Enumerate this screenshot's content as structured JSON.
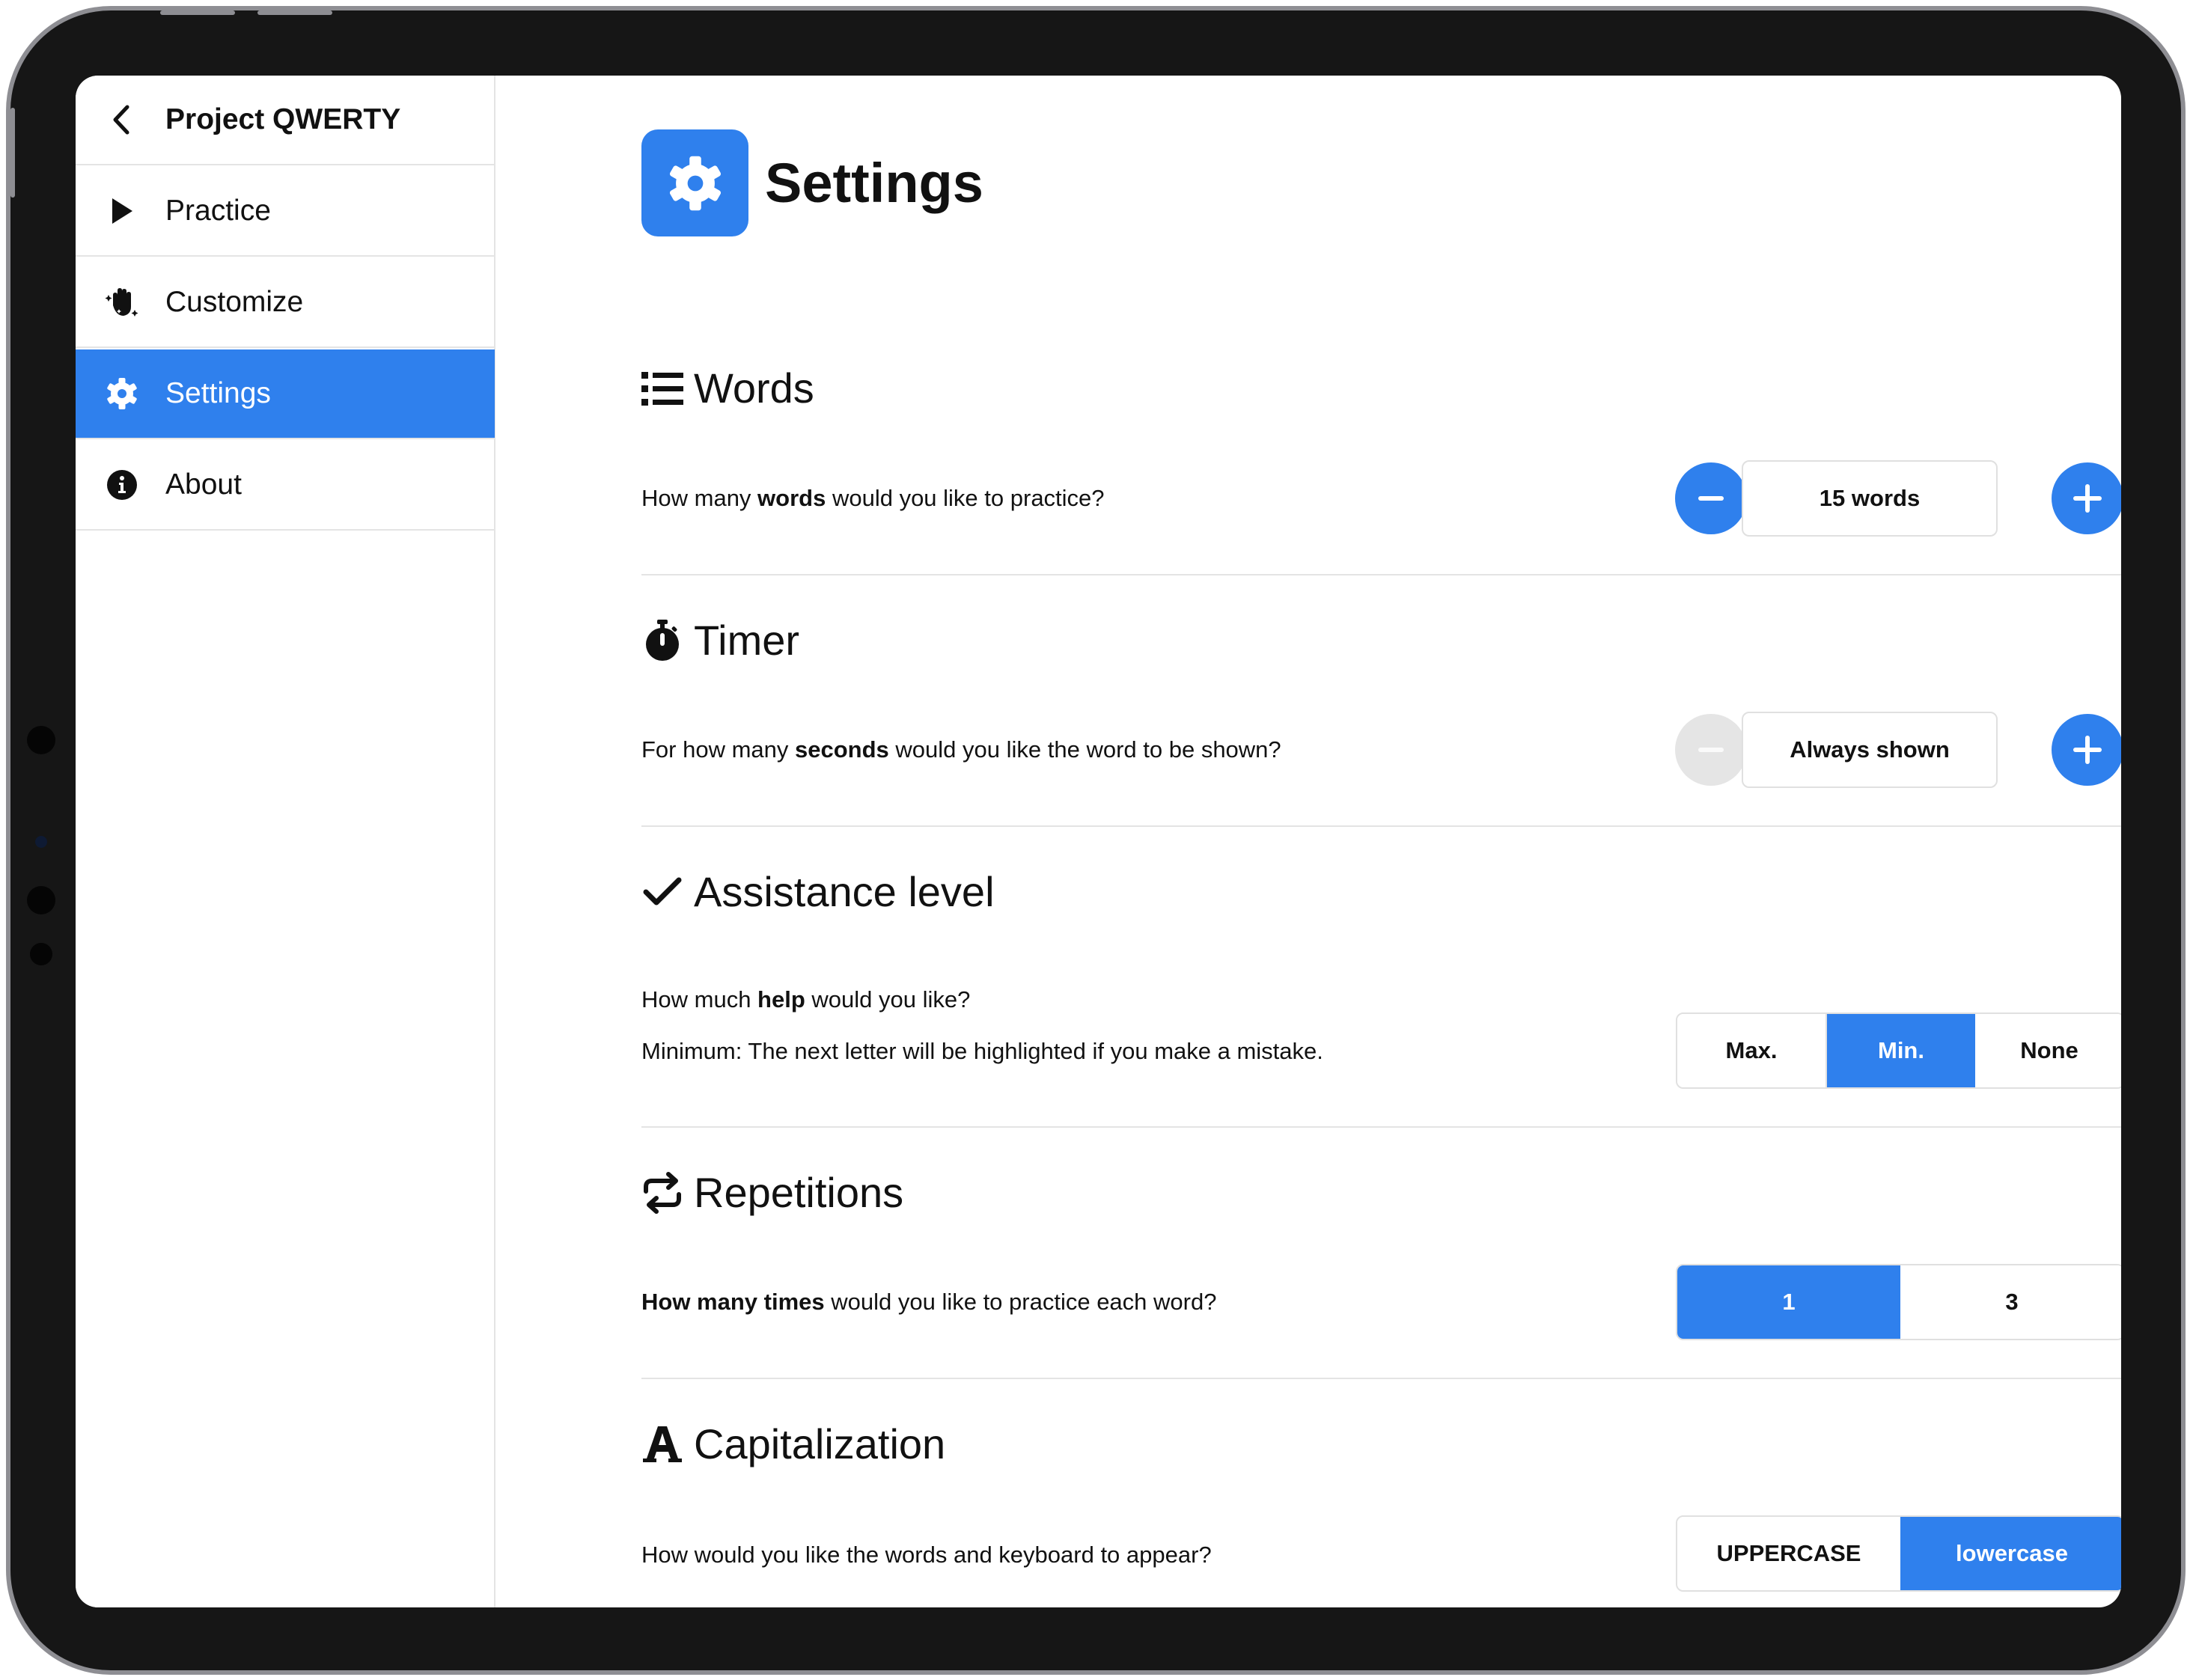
{
  "sidebar": {
    "header": {
      "label": "Project QWERTY",
      "icon": "chevron-left-icon"
    },
    "items": [
      {
        "label": "Practice",
        "icon": "play-icon",
        "active": false
      },
      {
        "label": "Customize",
        "icon": "hand-sparkles-icon",
        "active": false
      },
      {
        "label": "Settings",
        "icon": "gear-icon",
        "active": true
      },
      {
        "label": "About",
        "icon": "info-circle-icon",
        "active": false
      }
    ]
  },
  "page": {
    "title": "Settings",
    "icon": "gear-icon"
  },
  "sections": {
    "words": {
      "title": "Words",
      "icon": "list-icon",
      "q_pre": "How many ",
      "q_bold": "words",
      "q_post": " would you like to practice?",
      "value": "15 words",
      "decrement_enabled": true,
      "increment_enabled": true
    },
    "timer": {
      "title": "Timer",
      "icon": "stopwatch-icon",
      "q_pre": "For how many ",
      "q_bold": "seconds",
      "q_post": " would you like the word to be shown?",
      "value": "Always shown",
      "decrement_enabled": false,
      "increment_enabled": true
    },
    "assistance": {
      "title": "Assistance level",
      "icon": "checkmark-icon",
      "q_pre": "How much ",
      "q_bold": "help",
      "q_post": " would you like?",
      "description": "Minimum: The next letter will be highlighted if you make a mistake.",
      "options": [
        "Max.",
        "Min.",
        "None"
      ],
      "selected": "Min."
    },
    "repetitions": {
      "title": "Repetitions",
      "icon": "repeat-icon",
      "q_bold": "How many times",
      "q_post": " would you like to practice each word?",
      "options": [
        "1",
        "3"
      ],
      "selected": "1"
    },
    "capitalization": {
      "title": "Capitalization",
      "icon": "font-letter-a-icon",
      "q_text": "How would you like the words and keyboard to appear?",
      "options": [
        "UPPERCASE",
        "lowercase"
      ],
      "selected": "lowercase"
    }
  },
  "colors": {
    "accent": "#2f80ed",
    "disabled": "#e5e5e5",
    "divider": "#e4e4e4",
    "bezel": "#161616"
  }
}
